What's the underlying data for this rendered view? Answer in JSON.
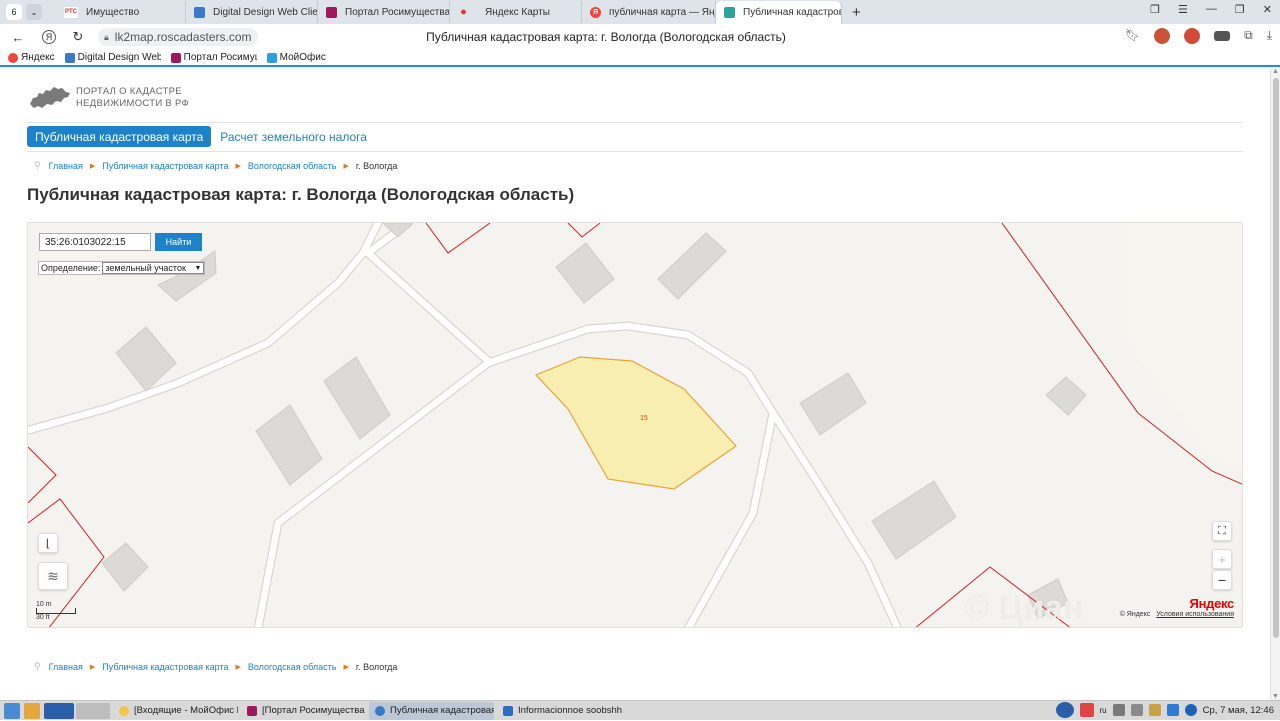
{
  "browser": {
    "tab_counter": "6",
    "tabs": [
      {
        "label": "Имущество",
        "icon": "rts-icon",
        "icon_text": "РТС",
        "color": "#e5312d"
      },
      {
        "label": "Digital Design Web Client",
        "icon": "dd-icon",
        "icon_text": "",
        "color": "#3a79c9"
      },
      {
        "label": "Портал Росимущества",
        "icon": "rosim-icon",
        "icon_text": "",
        "color": "#a0175a"
      },
      {
        "label": "Яндекс Карты",
        "icon": "map-pin-icon",
        "icon_text": "",
        "color": "#e5312d"
      },
      {
        "label": "публичная карта — Яндекс",
        "icon": "yandex-icon",
        "icon_text": "Я",
        "color": "#f0453a"
      },
      {
        "label": "Публичная кадастровая",
        "icon": "cadastre-icon",
        "icon_text": "",
        "color": "#2aa39a"
      }
    ],
    "url": "lk2map.roscadasters.com",
    "page_title": "Публичная кадастровая карта: г. Вологда (Вологодская область)",
    "bookmarks": [
      {
        "label": "Яндекс",
        "color": "#f0453a"
      },
      {
        "label": "Digital Design Web",
        "color": "#3a79c9"
      },
      {
        "label": "Портал Росимущества",
        "color": "#a0175a"
      },
      {
        "label": "МойОфис",
        "color": "#2d9fe0"
      }
    ]
  },
  "site": {
    "logo_line1": "ПОРТАЛ О КАДАСТРЕ",
    "logo_line2": "НЕДВИЖИМОСТИ В РФ",
    "nav_active": "Публичная кадастровая карта",
    "nav_other": "Расчет земельного налога",
    "breadcrumb": [
      "Главная",
      "Публичная кадастровая карта",
      "Вологодская область",
      "г. Вологда"
    ],
    "heading": "Публичная кадастровая карта: г. Вологда (Вологодская область)"
  },
  "map": {
    "cadastral_number": "35:26:0103022:15",
    "find_label": "Найти",
    "definition_label": "Определение:",
    "definition_value": "земельный участок",
    "parcel_label": "15",
    "scale_m": "10 m",
    "scale_ft": "30 ft",
    "provider_logo": "Яндекс",
    "copyright": "© Яндекс",
    "terms": "Условия использования",
    "parcel_fill": "#f8eeb0",
    "parcel_stroke": "#e8a33a",
    "boundary_color": "#d42020"
  },
  "taskbar": {
    "items": [
      {
        "label": "[Входящие - МойОфис П...",
        "color": "#f2c744"
      },
      {
        "label": "[Портал Росимущества - ...",
        "color": "#a0175a"
      },
      {
        "label": "Публичная кадастровая ...",
        "color": "#3a79c9"
      },
      {
        "label": "Informacionnoe soobshhe...",
        "color": "#2b6cc4"
      }
    ],
    "lang": "ru",
    "clock": "Ср, 7 мая, 12:46"
  }
}
